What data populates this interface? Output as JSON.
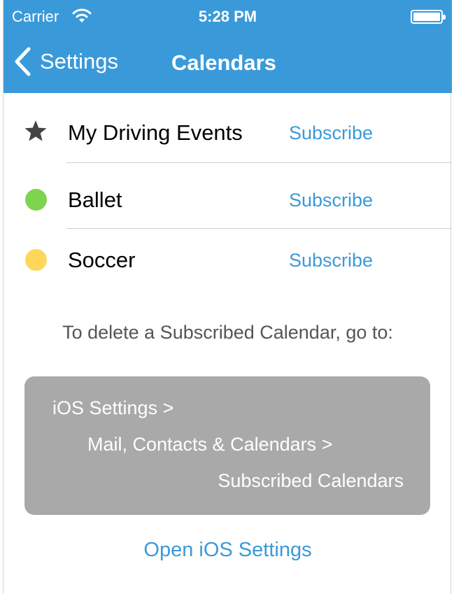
{
  "status_bar": {
    "carrier": "Carrier",
    "time": "5:28 PM",
    "icons": [
      "wifi-icon",
      "battery-icon"
    ]
  },
  "nav": {
    "back_label": "Settings",
    "title": "Calendars",
    "back_icon": "chevron-left-icon"
  },
  "calendars": [
    {
      "name": "My Driving Events",
      "action": "Subscribe",
      "icon": "star-icon",
      "color": "#444444"
    },
    {
      "name": "Ballet",
      "action": "Subscribe",
      "icon": "dot",
      "color": "#7ed44f"
    },
    {
      "name": "Soccer",
      "action": "Subscribe",
      "icon": "dot",
      "color": "#fcd75a"
    }
  ],
  "hint": "To delete a Subscribed Calendar, go to:",
  "path": {
    "line1": "iOS Settings >",
    "line2": "Mail, Contacts & Calendars >",
    "line3": "Subscribed Calendars"
  },
  "open_settings_label": "Open iOS Settings",
  "colors": {
    "accent": "#3a9ad9",
    "path_box": "#a9a9a9"
  }
}
